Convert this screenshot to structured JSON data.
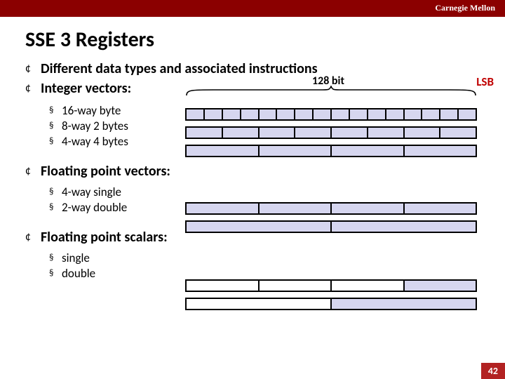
{
  "brand": "Carnegie Mellon",
  "title": "SSE 3 Registers",
  "width_label": "128 bit",
  "lsb_label": "LSB",
  "page_number": "42",
  "sections": [
    {
      "heading": "Different data types and associated instructions",
      "items": []
    },
    {
      "heading": "Integer vectors:",
      "items": [
        {
          "label": "16-way byte"
        },
        {
          "label": "8-way 2 bytes"
        },
        {
          "label": "4-way 4 bytes"
        }
      ]
    },
    {
      "heading": "Floating point vectors:",
      "items": [
        {
          "label": "4-way single"
        },
        {
          "label": "2-way double"
        }
      ]
    },
    {
      "heading": "Floating point scalars:",
      "items": [
        {
          "label": "single"
        },
        {
          "label": "double"
        }
      ]
    }
  ],
  "chart_data": [
    {
      "type": "table",
      "title": "16-way byte",
      "cells": 16,
      "total_bits": 128,
      "bits_per_cell": 8
    },
    {
      "type": "table",
      "title": "8-way 2 bytes",
      "cells": 8,
      "total_bits": 128,
      "bits_per_cell": 16
    },
    {
      "type": "table",
      "title": "4-way 4 bytes",
      "cells": 4,
      "total_bits": 128,
      "bits_per_cell": 32
    },
    {
      "type": "table",
      "title": "4-way single",
      "cells": 4,
      "total_bits": 128,
      "bits_per_cell": 32
    },
    {
      "type": "table",
      "title": "2-way double",
      "cells": 2,
      "total_bits": 128,
      "bits_per_cell": 64
    },
    {
      "type": "table",
      "title": "single",
      "cells": 4,
      "total_bits": 128,
      "bits_per_cell": 32,
      "active_cells": [
        3
      ]
    },
    {
      "type": "table",
      "title": "double",
      "cells": 2,
      "total_bits": 128,
      "bits_per_cell": 64,
      "active_cells": [
        1
      ]
    }
  ]
}
